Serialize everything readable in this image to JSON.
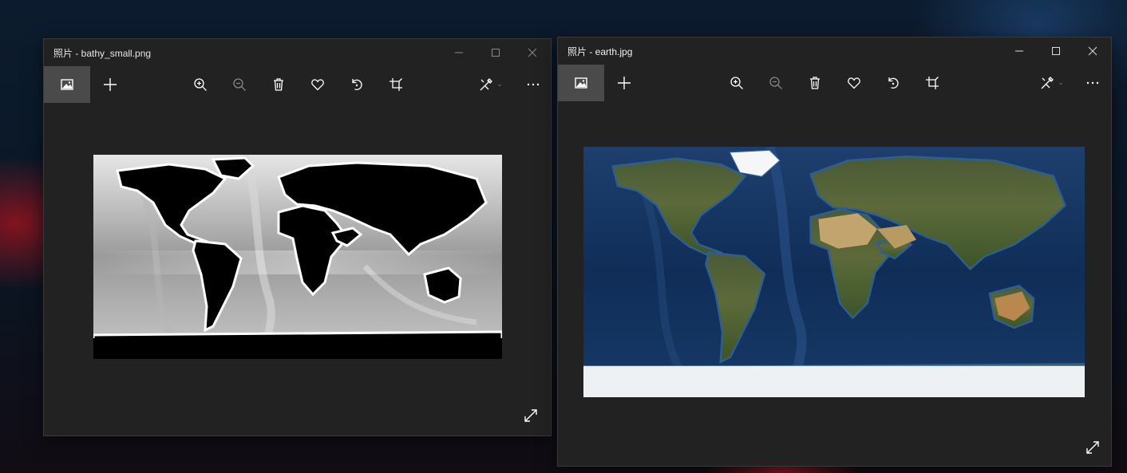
{
  "windows": [
    {
      "title": "照片 - bathy_small.png",
      "image_label": "bathy_small.png"
    },
    {
      "title": "照片 - earth.jpg",
      "image_label": "earth.jpg"
    }
  ],
  "toolbar_icons": [
    "gallery-icon",
    "add-icon",
    "zoom-in-icon",
    "zoom-out-icon",
    "delete-icon",
    "favorite-icon",
    "rotate-icon",
    "crop-icon",
    "edit-icon",
    "more-icon"
  ],
  "window_controls": [
    "minimize",
    "maximize",
    "close"
  ],
  "colors": {
    "window_bg": "#222222",
    "gallery_selected": "#4a4a4a",
    "ocean_blue": "#123a6b",
    "land_green": "#3f5a2a",
    "desert": "#b89a62"
  }
}
